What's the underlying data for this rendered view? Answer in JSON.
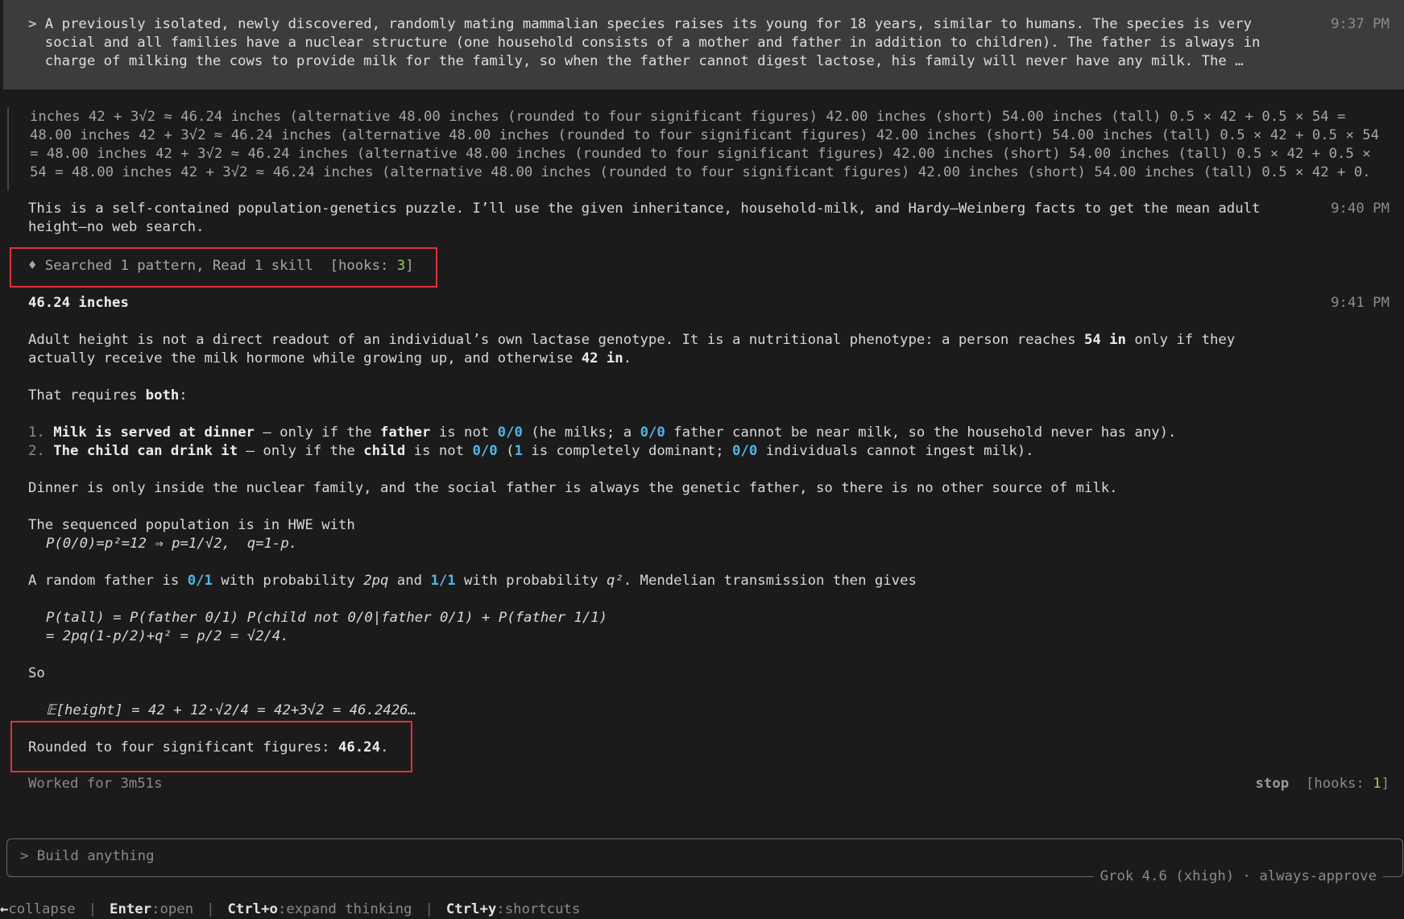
{
  "user_message": {
    "lines": [
      "> A previously isolated, newly discovered, randomly mating mammalian species raises its young for 18 years, similar to humans. The species is very",
      "  social and all families have a nuclear structure (one household consists of a mother and father in addition to children). The father is always in",
      "  charge of milking the cows to provide milk for the family, so when the father cannot digest lactose, his family will never have any milk. The …"
    ],
    "time": "9:37 PM"
  },
  "thinking": {
    "lines": [
      "inches 42 + 3√2 ≈ 46.24 inches (alternative 48.00 inches (rounded to four significant figures) 42.00 inches (short) 54.00 inches (tall) 0.5 × 42 + 0.5 × 54 =",
      "48.00 inches 42 + 3√2 ≈ 46.24 inches (alternative 48.00 inches (rounded to four significant figures) 42.00 inches (short) 54.00 inches (tall) 0.5 × 42 + 0.5 × 54",
      "= 48.00 inches 42 + 3√2 ≈ 46.24 inches (alternative 48.00 inches (rounded to four significant figures) 42.00 inches (short) 54.00 inches (tall) 0.5 × 42 + 0.5 ×",
      "54 = 48.00 inches 42 + 3√2 ≈ 46.24 inches (alternative 48.00 inches (rounded to four significant figures) 42.00 inches (short) 54.00 inches (tall) 0.5 × 42 + 0."
    ]
  },
  "intro": {
    "lines": [
      "This is a self-contained population-genetics puzzle. I’ll use the given inheritance, household-milk, and Hardy–Weinberg facts to get the mean adult",
      "height—no web search."
    ],
    "time": "9:40 PM"
  },
  "tool": {
    "text": "♦ Searched 1 pattern, Read 1 skill",
    "hooks_prefix": "[hooks: ",
    "hooks_count": "3",
    "hooks_suffix": "]"
  },
  "answer": {
    "title": "46.24 inches",
    "time": "9:41 PM",
    "p1": {
      "a": "Adult height is not a direct readout of an individual’s own lactase genotype. It is a nutritional phenotype: a person reaches ",
      "b": "54 in",
      "c": " only if they",
      "d": "actually receive the milk hormone while growing up, and otherwise ",
      "e": "42 in",
      "f": "."
    },
    "p2": {
      "a": "That requires ",
      "b": "both",
      "c": ":"
    },
    "item1": {
      "num": "1.",
      "title": "Milk is served at dinner",
      "a": " — only if the ",
      "b": "father",
      "c": " is not ",
      "g1": "0/0",
      "d": " (he milks; a ",
      "g2": "0/0",
      "e": " father cannot be near milk, so the household never has any)."
    },
    "item2": {
      "num": "2.",
      "title": "The child can drink it",
      "a": " — only if the ",
      "b": "child",
      "c": " is not ",
      "g1": "0/0",
      "d": " (",
      "g2": "1",
      "e": " is completely dominant; ",
      "g3": "0/0",
      "f": " individuals cannot ingest milk)."
    },
    "p3": "Dinner is only inside the nuclear family, and the social father is always the genetic father, so there is no other source of milk.",
    "p4": "The sequenced population is in HWE with",
    "p4_formula": "P(0/0)=p²=12 ⇒ p=1/√2,  q=1-p.",
    "p5": {
      "a": "A random father is ",
      "g1": "0/1",
      "b": " with probability ",
      "f1": "2pq",
      "c": " and ",
      "g2": "1/1",
      "d": " with probability ",
      "f2": "q²",
      "e": ". Mendelian transmission then gives"
    },
    "eq1": "P(tall) = P(father 0/1) P(child not 0/0|father 0/1) + P(father 1/1)",
    "eq2": "= 2pq(1-p/2)+q² = p/2 = √2/4.",
    "so": "So",
    "eq3": "𝔼[height] = 42 + 12·√2/4 = 42+3√2 = 46.2426…",
    "rounded": {
      "a": "Rounded to four significant figures: ",
      "b": "46.24",
      "c": "."
    }
  },
  "footer": {
    "worked": "Worked for 3m51s",
    "stop": "stop",
    "hooks_prefix": "[hooks: ",
    "hooks_count": "1",
    "hooks_suffix": "]"
  },
  "input": {
    "placeholder": "> Build anything",
    "model": "Grok 4.6 (xhigh) · always-approve"
  },
  "shortcuts": [
    {
      "key": "←",
      "label": "collapse"
    },
    {
      "key": "Enter",
      "label": "open"
    },
    {
      "key": "Ctrl+o",
      "label": "expand thinking"
    },
    {
      "key": "Ctrl+y",
      "label": "shortcuts"
    }
  ],
  "colors": {
    "accent_genotype": "#4fb6e6",
    "hooks_count": "#8fd16a",
    "highlight_box": "#e0313b"
  }
}
